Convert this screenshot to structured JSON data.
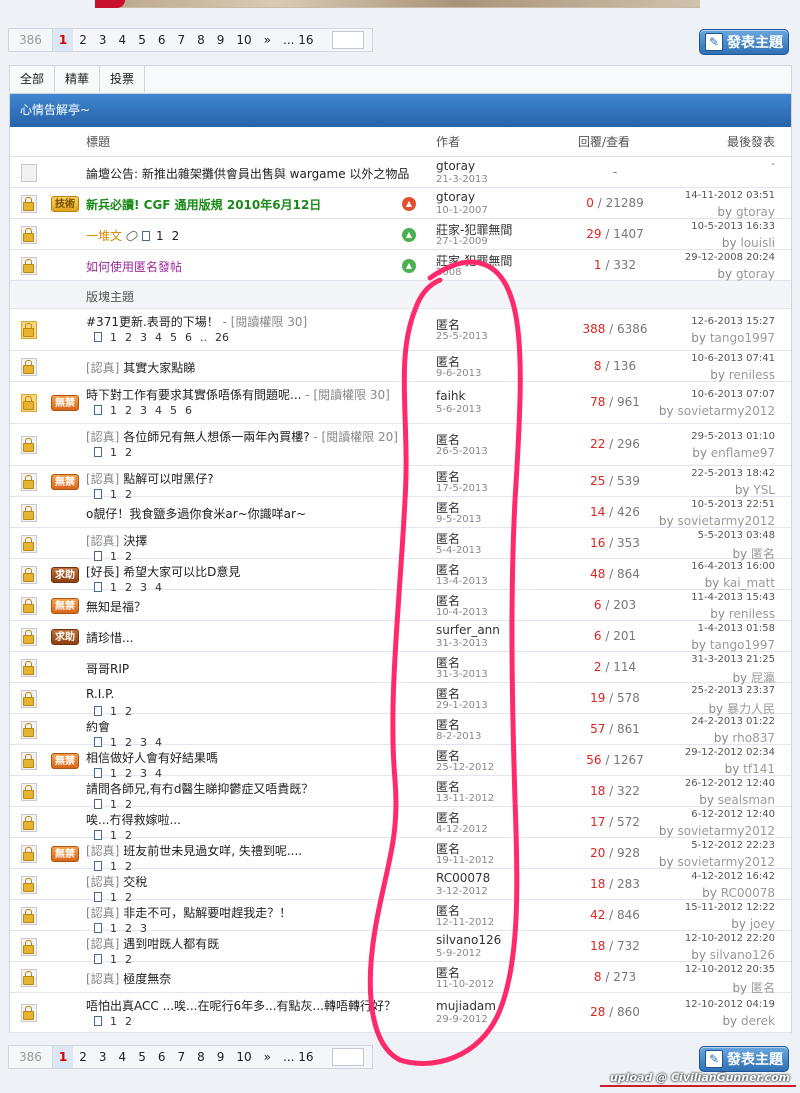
{
  "pagination": {
    "total": "386",
    "pages": [
      "1",
      "2",
      "3",
      "4",
      "5",
      "6",
      "7",
      "8",
      "9",
      "10",
      "»",
      "... 16"
    ],
    "current": "1"
  },
  "new_post_button": "發表主題",
  "tabs": [
    "全部",
    "精華",
    "投票"
  ],
  "board_title": "心情告解亭~",
  "columns": {
    "title": "標題",
    "author": "作者",
    "stats": "回覆/查看",
    "last": "最後發表"
  },
  "section_label": "版塊主題",
  "pinned": [
    {
      "title": "論壇公告: 新推出雜架攤供會員出售與 wargame 以外之物品",
      "author": "gtoray",
      "date": "21-3-2013",
      "stats": "-",
      "last_time": "-",
      "last_user": ""
    },
    {
      "tag": "技術",
      "title": "新兵必讀! CGF 通用版規 2010年6月12日",
      "author": "gtoray",
      "date": "10-1-2007",
      "replies": "0",
      "views": "21289",
      "last_time": "14-11-2012 03:51",
      "last_user": "gtoray"
    },
    {
      "title": "一堆文",
      "pages": [
        "1",
        "2"
      ],
      "author": "莊家-犯罪無間",
      "date": "27-1-2009",
      "replies": "29",
      "views": "1407",
      "last_time": "10-5-2013 16:33",
      "last_user": "louisli"
    },
    {
      "title": "如何使用匿名發帖",
      "author": "莊家-犯罪無間",
      "date": "2008",
      "replies": "1",
      "views": "332",
      "last_time": "29-12-2008 20:24",
      "last_user": "gtoray"
    }
  ],
  "threads": [
    {
      "title": "#371更新.表哥的下場！",
      "perm": "- [閱讀權限 30]",
      "pages": [
        "1",
        "2",
        "3",
        "4",
        "5",
        "6",
        "..",
        "26"
      ],
      "author": "匿名",
      "date": "25-5-2013",
      "replies": "388",
      "views": "6386",
      "last_time": "12-6-2013 15:27",
      "last_user": "tango1997"
    },
    {
      "prefix": "[認真]",
      "title": "其實大家點睇",
      "author": "匿名",
      "date": "9-6-2013",
      "replies": "8",
      "views": "136",
      "last_time": "10-6-2013 07:41",
      "last_user": "reniless"
    },
    {
      "tag": "無禁",
      "title": "時下對工作有要求其實係唔係有問題呢...",
      "perm": "- [閱讀權限 30]",
      "pages": [
        "1",
        "2",
        "3",
        "4",
        "5",
        "6"
      ],
      "author": "faihk",
      "date": "5-6-2013",
      "replies": "78",
      "views": "961",
      "last_time": "10-6-2013 07:07",
      "last_user": "sovietarmy2012"
    },
    {
      "prefix": "[認真]",
      "title": "各位師兄有無人想係一兩年內買樓?",
      "perm": "- [閱讀權限 20]",
      "pages": [
        "1",
        "2"
      ],
      "author": "匿名",
      "date": "26-5-2013",
      "replies": "22",
      "views": "296",
      "last_time": "29-5-2013 01:10",
      "last_user": "enflame97"
    },
    {
      "tag": "無禁",
      "prefix": "[認真]",
      "title": "點解可以咁黑仔?",
      "pages": [
        "1",
        "2"
      ],
      "author": "匿名",
      "date": "17-5-2013",
      "replies": "25",
      "views": "539",
      "last_time": "22-5-2013 18:42",
      "last_user": "YSL"
    },
    {
      "title": "o靚仔！我食鹽多過你食米ar~你識咩ar~",
      "author": "匿名",
      "date": "9-5-2013",
      "replies": "14",
      "views": "426",
      "last_time": "10-5-2013 22:51",
      "last_user": "sovietarmy2012"
    },
    {
      "prefix": "[認真]",
      "title": "決擇",
      "pages": [
        "1",
        "2"
      ],
      "author": "匿名",
      "date": "5-4-2013",
      "replies": "16",
      "views": "353",
      "last_time": "5-5-2013 03:48",
      "last_user": "匿名"
    },
    {
      "tag": "求助",
      "title": "[好長] 希望大家可以比D意見",
      "pages": [
        "1",
        "2",
        "3",
        "4"
      ],
      "author": "匿名",
      "date": "13-4-2013",
      "replies": "48",
      "views": "864",
      "last_time": "16-4-2013 16:00",
      "last_user": "kai_matt"
    },
    {
      "tag": "無禁",
      "title": "無知是福？",
      "author": "匿名",
      "date": "10-4-2013",
      "replies": "6",
      "views": "203",
      "last_time": "11-4-2013 15:43",
      "last_user": "reniless"
    },
    {
      "tag": "求助",
      "title": "請珍惜...",
      "author": "surfer_ann",
      "date": "31-3-2013",
      "replies": "6",
      "views": "201",
      "last_time": "1-4-2013 01:58",
      "last_user": "tango1997"
    },
    {
      "title": "哥哥RIP",
      "author": "匿名",
      "date": "31-3-2013",
      "replies": "2",
      "views": "114",
      "last_time": "31-3-2013 21:25",
      "last_user": "屁瀛"
    },
    {
      "title": "R.I.P.",
      "pages": [
        "1",
        "2"
      ],
      "author": "匿名",
      "date": "29-1-2013",
      "replies": "19",
      "views": "578",
      "last_time": "25-2-2013 23:37",
      "last_user": "暴力人民"
    },
    {
      "title": "約會",
      "pages": [
        "1",
        "2",
        "3",
        "4"
      ],
      "author": "匿名",
      "date": "8-2-2013",
      "replies": "57",
      "views": "861",
      "last_time": "24-2-2013 01:22",
      "last_user": "rho837"
    },
    {
      "tag": "無禁",
      "title": "相信做好人會有好結果嗎",
      "pages": [
        "1",
        "2",
        "3",
        "4"
      ],
      "author": "匿名",
      "date": "25-12-2012",
      "replies": "56",
      "views": "1267",
      "last_time": "29-12-2012 02:34",
      "last_user": "tf141"
    },
    {
      "title": "請問各師兄,有冇d醫生睇抑鬱症又唔貴既？",
      "pages": [
        "1",
        "2"
      ],
      "author": "匿名",
      "date": "13-11-2012",
      "replies": "18",
      "views": "322",
      "last_time": "26-12-2012 12:40",
      "last_user": "sealsman"
    },
    {
      "title": "唉...冇得救嫁啦...",
      "pages": [
        "1",
        "2"
      ],
      "author": "匿名",
      "date": "4-12-2012",
      "replies": "17",
      "views": "572",
      "last_time": "6-12-2012 12:40",
      "last_user": "sovietarmy2012"
    },
    {
      "tag": "無禁",
      "prefix": "[認真]",
      "title": "班友前世未見過女咩, 失禮到呢....",
      "pages": [
        "1",
        "2"
      ],
      "author": "匿名",
      "date": "19-11-2012",
      "replies": "20",
      "views": "928",
      "last_time": "5-12-2012 22:23",
      "last_user": "sovietarmy2012"
    },
    {
      "prefix": "[認真]",
      "title": "交稅",
      "pages": [
        "1",
        "2"
      ],
      "author": "RC00078",
      "date": "3-12-2012",
      "replies": "18",
      "views": "283",
      "last_time": "4-12-2012 16:42",
      "last_user": "RC00078"
    },
    {
      "prefix": "[認真]",
      "title": "非走不可，點解要咁趕我走？！",
      "pages": [
        "1",
        "2",
        "3"
      ],
      "author": "匿名",
      "date": "12-11-2012",
      "replies": "42",
      "views": "846",
      "last_time": "15-11-2012 12:22",
      "last_user": "joey"
    },
    {
      "prefix": "[認真]",
      "title": "遇到咁既人都有既",
      "pages": [
        "1",
        "2"
      ],
      "author": "silvano126",
      "date": "5-9-2012",
      "replies": "18",
      "views": "732",
      "last_time": "12-10-2012 22:20",
      "last_user": "silvano126"
    },
    {
      "prefix": "[認真]",
      "title": "極度無奈",
      "author": "匿名",
      "date": "11-10-2012",
      "replies": "8",
      "views": "273",
      "last_time": "12-10-2012 20:35",
      "last_user": "匿名"
    },
    {
      "title": "唔怕出真ACC ...唉...在呢行6年多...有點灰...轉唔轉行好？",
      "pages": [
        "1",
        "2"
      ],
      "author": "mujiadam",
      "date": "29-9-2012",
      "replies": "28",
      "views": "860",
      "last_time": "12-10-2012 04:19",
      "last_user": "derek"
    }
  ],
  "watermark": "upload @ CivilianGunner.com",
  "colors": {
    "accent": "#2763a8",
    "replies": "#dd2222",
    "scribble": "#ff2a6a"
  }
}
